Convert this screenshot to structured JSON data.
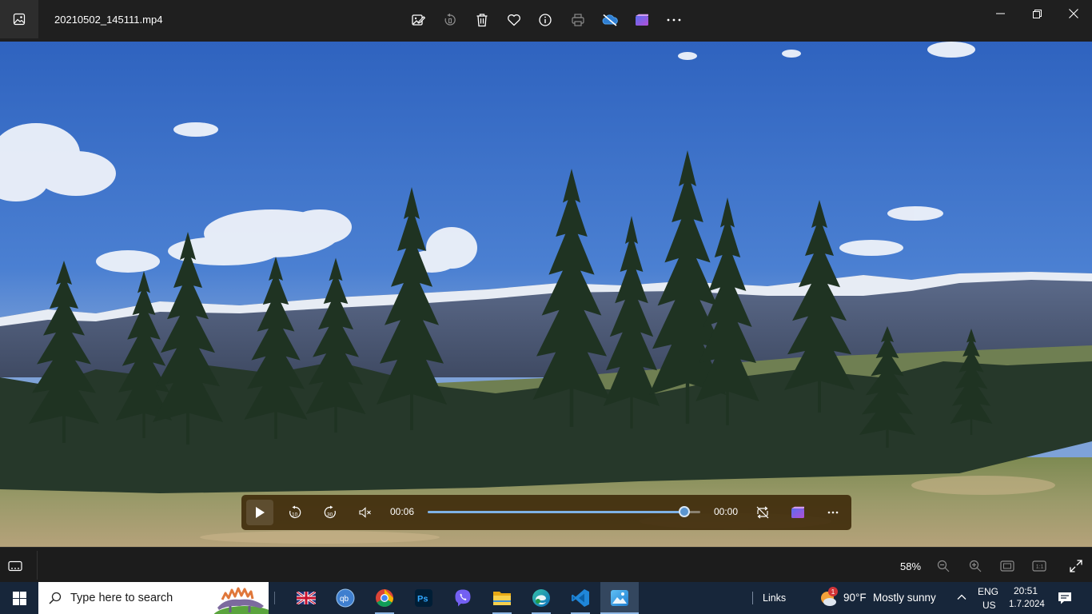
{
  "titlebar": {
    "file_name": "20210502_145111.mp4",
    "icons": [
      "photos-app-icon",
      "edit-image-icon",
      "rotate-icon",
      "delete-icon",
      "favorite-icon",
      "info-icon",
      "print-icon",
      "onedrive-off-icon",
      "clipchamp-icon",
      "more-icon",
      "minimize-icon",
      "restore-icon",
      "close-icon"
    ]
  },
  "media": {
    "elapsed": "00:06",
    "remaining": "00:00",
    "progress_fraction": 0.94,
    "icons": [
      "play-icon",
      "rewind-10-icon",
      "forward-30-icon",
      "mute-icon",
      "repeat-off-icon",
      "clipchamp-icon",
      "more-icon"
    ]
  },
  "zoombar": {
    "zoom_level": "58%",
    "icons": [
      "filmstrip-icon",
      "zoom-out-icon",
      "zoom-in-icon",
      "fit-window-icon",
      "actual-size-icon",
      "fullscreen-icon"
    ]
  },
  "taskbar": {
    "search_placeholder": "Type here to search",
    "apps": [
      "windows-start-icon",
      "uk-flag-icon",
      "qbittorrent-icon",
      "chrome-icon",
      "photoshop-icon",
      "viber-icon",
      "file-explorer-icon",
      "edge-icon",
      "vscode-icon",
      "photos-icon"
    ],
    "links_label": "Links",
    "weather": {
      "badge": "1",
      "temp": "90°F",
      "condition": "Mostly sunny"
    },
    "lang_top": "ENG",
    "lang_bottom": "US",
    "time": "20:51",
    "date": "1.7.2024"
  },
  "colors": {
    "sky": "#3f74c9",
    "titlebar": "#1f1f1f",
    "media_bar": "#3e2a0a",
    "seek_fill": "#7fb2e6",
    "taskbar": "#17263a"
  }
}
